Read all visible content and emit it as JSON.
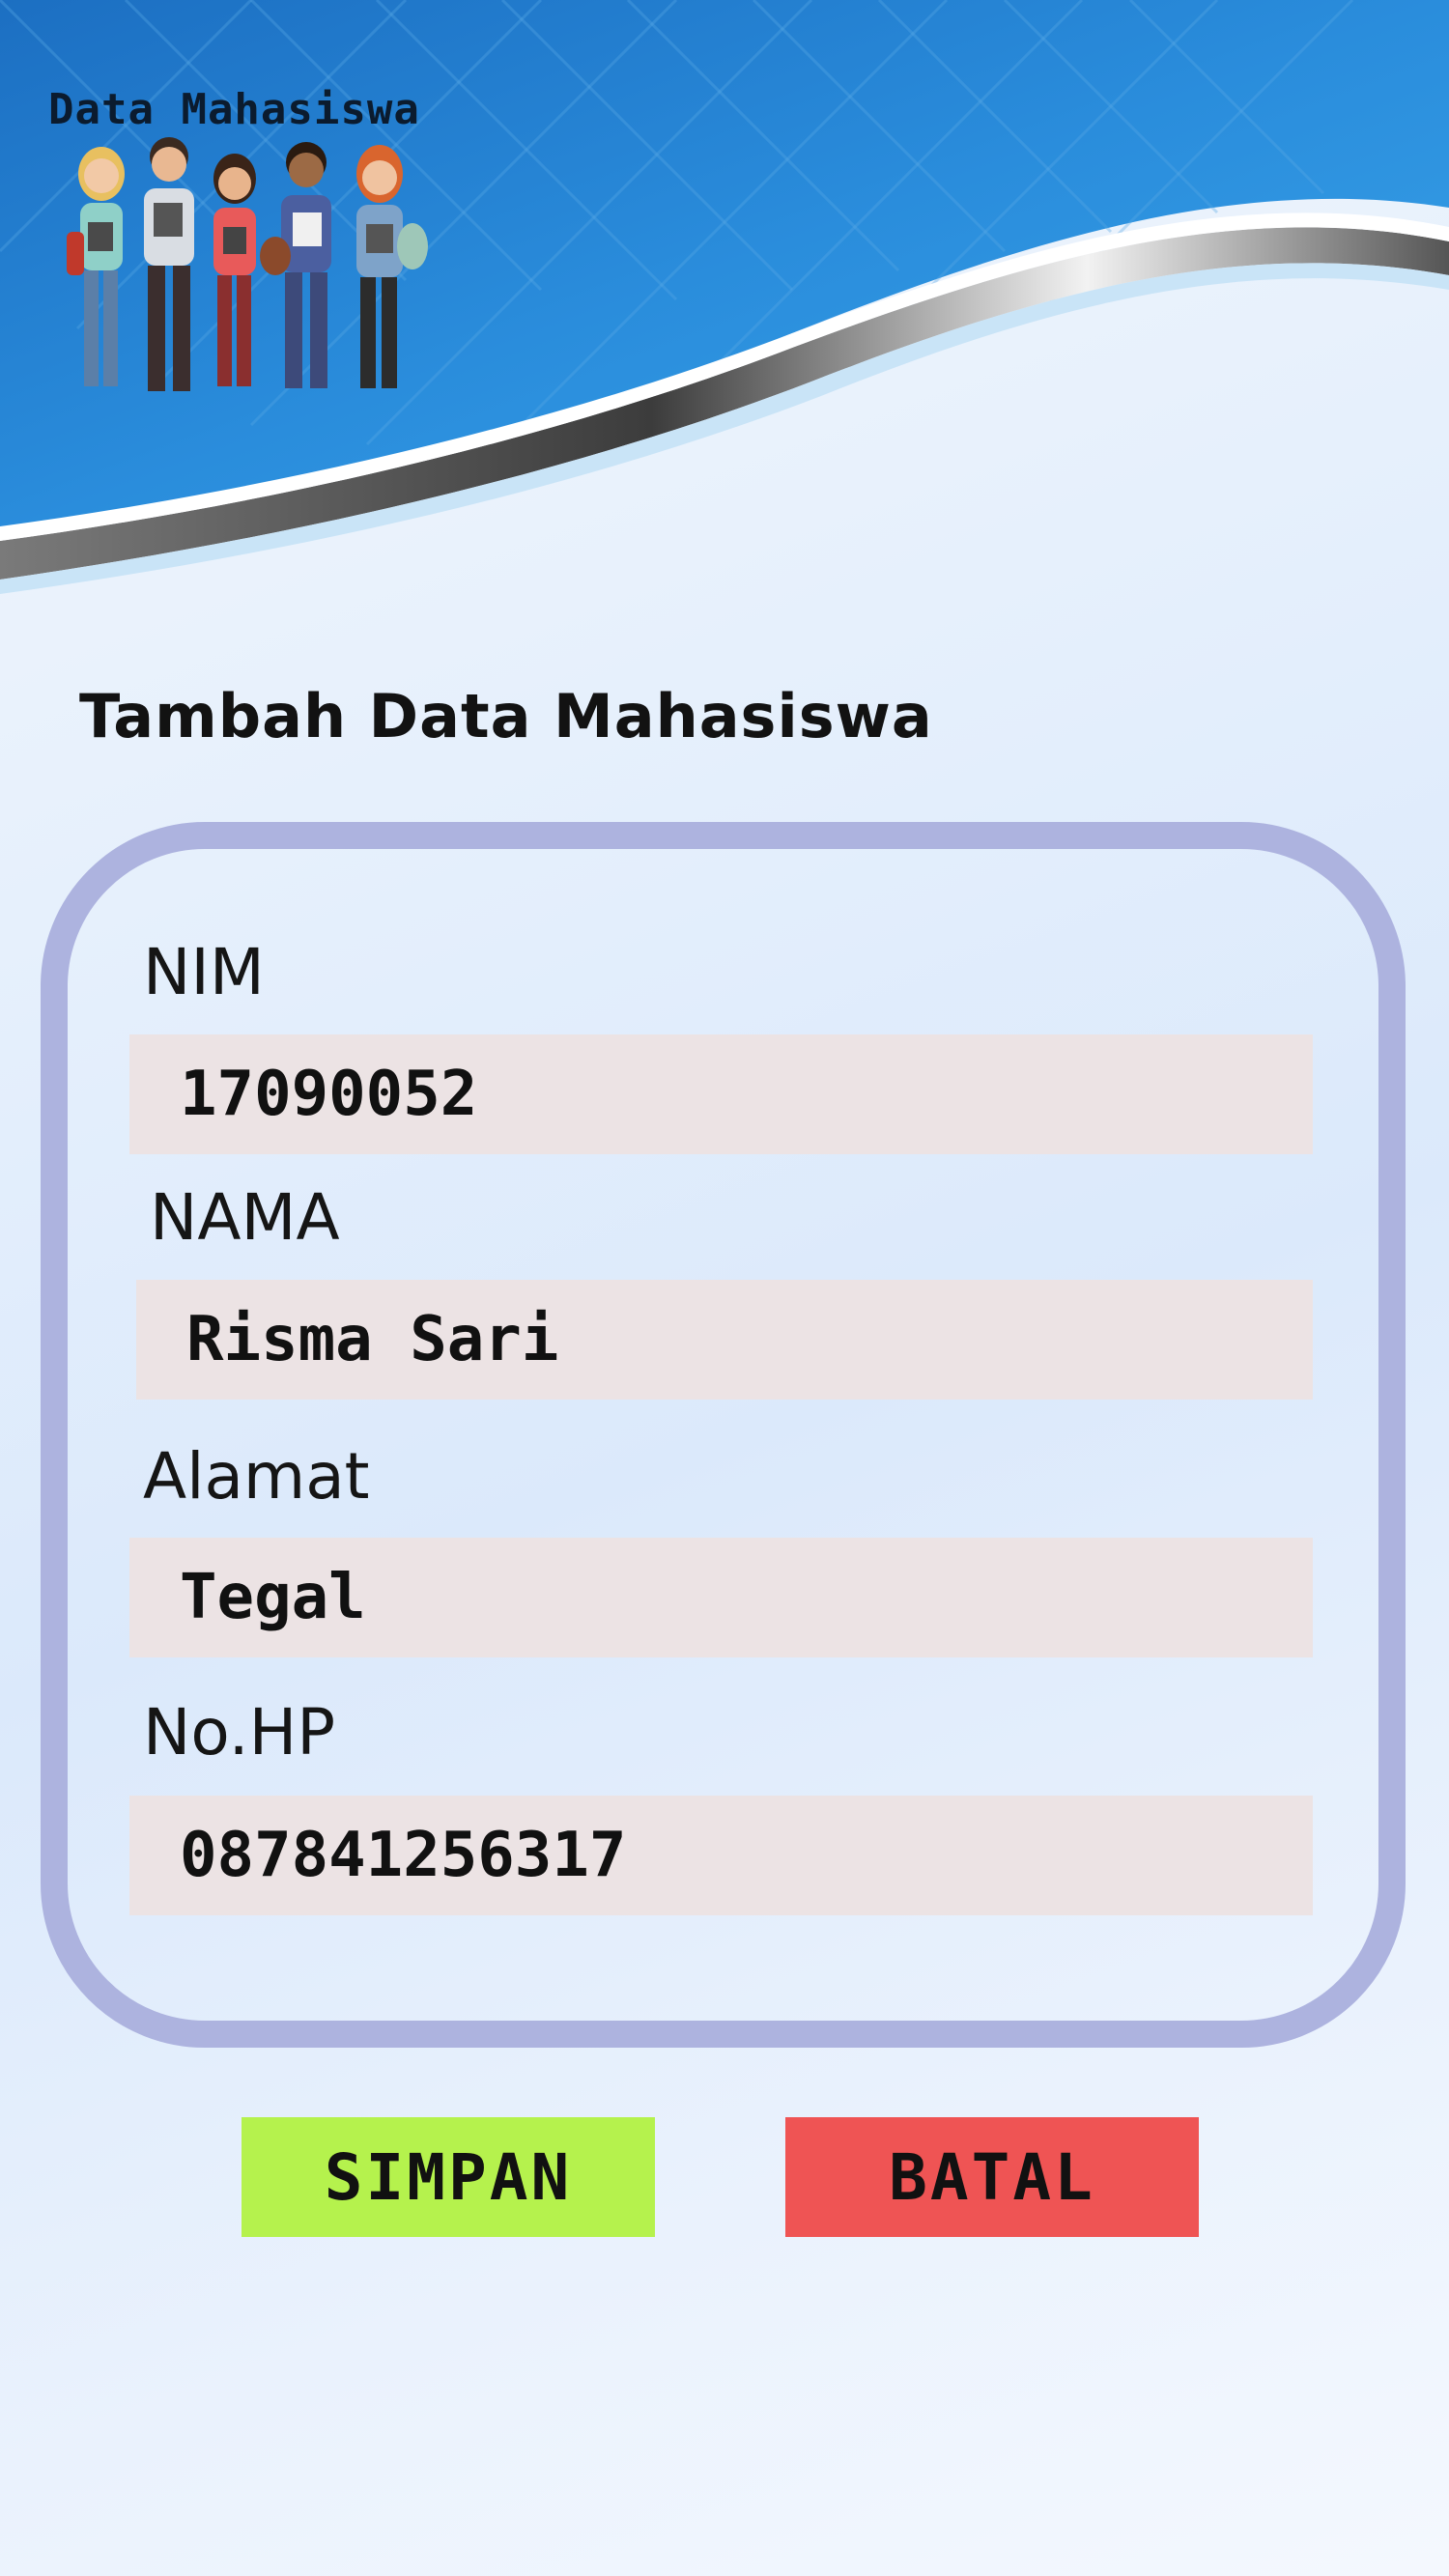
{
  "header": {
    "app_title": "Data Mahasiswa"
  },
  "form": {
    "heading": "Tambah Data Mahasiswa",
    "fields": [
      {
        "label": "NIM",
        "value": "17090052"
      },
      {
        "label": "NAMA",
        "value": "Risma Sari"
      },
      {
        "label": "Alamat",
        "value": "Tegal"
      },
      {
        "label": "No.HP",
        "value": "087841256317"
      }
    ]
  },
  "buttons": {
    "save_label": "SIMPAN",
    "cancel_label": "BATAL"
  },
  "colors": {
    "header_blue": "#1f7fd0",
    "card_border": "#adb3df",
    "input_bg": "#ece3e4",
    "save_button": "#b5f24d",
    "cancel_button": "#ef5454"
  }
}
